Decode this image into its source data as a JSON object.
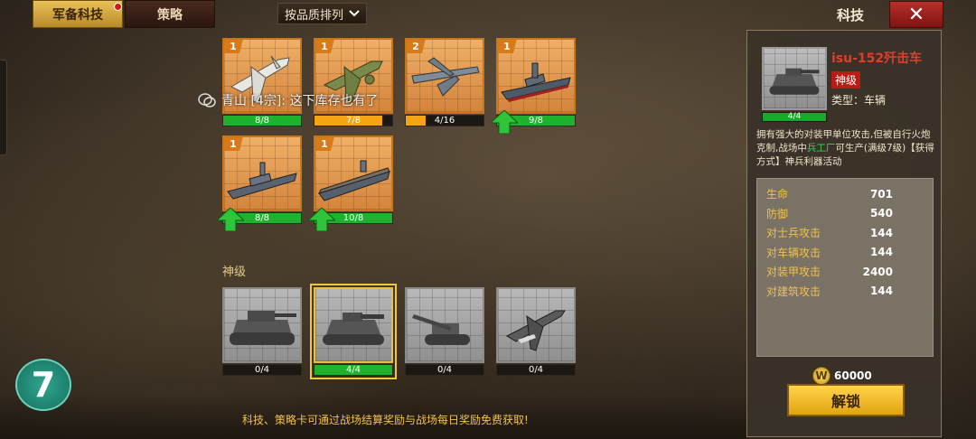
{
  "tabs": [
    {
      "label": "军备科技",
      "active": true,
      "has_notification": true
    },
    {
      "label": "策略",
      "active": false
    }
  ],
  "sort_button": {
    "label": "按品质排列",
    "icon": "chevron-down-icon"
  },
  "header": {
    "title": "科技",
    "close_icon": "close-icon"
  },
  "chat_message": {
    "text": "青山 [4宗]: 这下库存也有了"
  },
  "cards_top": [
    {
      "level": "1",
      "progress_text": "8/8",
      "progress": 1.0,
      "bar_color": "#1fb22f",
      "upgrade_arrow": false,
      "unit": "white plane"
    },
    {
      "level": "1",
      "progress_text": "7/8",
      "progress": 0.875,
      "bar_color": "#f3a516",
      "upgrade_arrow": false,
      "unit": "green plane"
    },
    {
      "level": "2",
      "progress_text": "4/16",
      "progress": 0.25,
      "bar_color": "#f3a516",
      "upgrade_arrow": false,
      "unit": "bomber"
    },
    {
      "level": "1",
      "progress_text": "9/8",
      "progress": 1.0,
      "bar_color": "#1fb22f",
      "upgrade_arrow": true,
      "unit": "battleship"
    },
    {
      "level": "1",
      "progress_text": "8/8",
      "progress": 1.0,
      "bar_color": "#1fb22f",
      "upgrade_arrow": true,
      "unit": "cruiser"
    },
    {
      "level": "1",
      "progress_text": "10/8",
      "progress": 1.0,
      "bar_color": "#1fb22f",
      "upgrade_arrow": true,
      "unit": "carrier"
    }
  ],
  "section": {
    "label": "神级"
  },
  "cards_divine": [
    {
      "progress_text": "0/4",
      "progress": 0.0,
      "selected": false,
      "unit": "heavy tank"
    },
    {
      "progress_text": "4/4",
      "progress": 1.0,
      "selected": true,
      "unit": "tank destroyer"
    },
    {
      "progress_text": "0/4",
      "progress": 0.0,
      "selected": false,
      "unit": "artillery"
    },
    {
      "progress_text": "0/4",
      "progress": 0.0,
      "selected": false,
      "unit": "fighter"
    }
  ],
  "hint": "科技、策略卡可通过战场结算奖励与战场每日奖励免费获取!",
  "detail": {
    "name": "isu-152歼击车",
    "grade": "神级",
    "type_label": "类型：车辆",
    "thumb_progress": "4/4",
    "desc_before": "拥有强大的对装甲单位攻击,但被自行火炮克制,战场中",
    "desc_highlight": "兵工厂",
    "desc_after": "可生产(满级7级)【获得方式】神兵利器活动",
    "stats": [
      {
        "label": "生命",
        "value": "701"
      },
      {
        "label": "防御",
        "value": "540"
      },
      {
        "label": "对士兵攻击",
        "value": "144"
      },
      {
        "label": "对车辆攻击",
        "value": "144"
      },
      {
        "label": "对装甲攻击",
        "value": "2400"
      },
      {
        "label": "对建筑攻击",
        "value": "144"
      }
    ],
    "cost": "60000",
    "coin_symbol": "W",
    "unlock_label": "解锁"
  },
  "logo_text": "7"
}
